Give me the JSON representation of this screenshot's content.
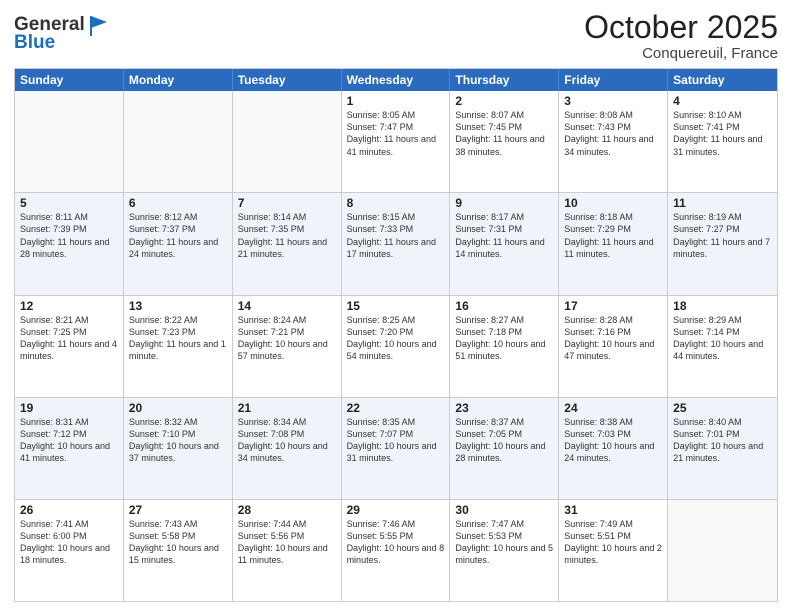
{
  "logo": {
    "line1": "General",
    "line2": "Blue"
  },
  "header": {
    "month": "October 2025",
    "location": "Conquereuil, France"
  },
  "days": [
    "Sunday",
    "Monday",
    "Tuesday",
    "Wednesday",
    "Thursday",
    "Friday",
    "Saturday"
  ],
  "rows": [
    [
      {
        "day": "",
        "text": ""
      },
      {
        "day": "",
        "text": ""
      },
      {
        "day": "",
        "text": ""
      },
      {
        "day": "1",
        "text": "Sunrise: 8:05 AM\nSunset: 7:47 PM\nDaylight: 11 hours and 41 minutes."
      },
      {
        "day": "2",
        "text": "Sunrise: 8:07 AM\nSunset: 7:45 PM\nDaylight: 11 hours and 38 minutes."
      },
      {
        "day": "3",
        "text": "Sunrise: 8:08 AM\nSunset: 7:43 PM\nDaylight: 11 hours and 34 minutes."
      },
      {
        "day": "4",
        "text": "Sunrise: 8:10 AM\nSunset: 7:41 PM\nDaylight: 11 hours and 31 minutes."
      }
    ],
    [
      {
        "day": "5",
        "text": "Sunrise: 8:11 AM\nSunset: 7:39 PM\nDaylight: 11 hours and 28 minutes."
      },
      {
        "day": "6",
        "text": "Sunrise: 8:12 AM\nSunset: 7:37 PM\nDaylight: 11 hours and 24 minutes."
      },
      {
        "day": "7",
        "text": "Sunrise: 8:14 AM\nSunset: 7:35 PM\nDaylight: 11 hours and 21 minutes."
      },
      {
        "day": "8",
        "text": "Sunrise: 8:15 AM\nSunset: 7:33 PM\nDaylight: 11 hours and 17 minutes."
      },
      {
        "day": "9",
        "text": "Sunrise: 8:17 AM\nSunset: 7:31 PM\nDaylight: 11 hours and 14 minutes."
      },
      {
        "day": "10",
        "text": "Sunrise: 8:18 AM\nSunset: 7:29 PM\nDaylight: 11 hours and 11 minutes."
      },
      {
        "day": "11",
        "text": "Sunrise: 8:19 AM\nSunset: 7:27 PM\nDaylight: 11 hours and 7 minutes."
      }
    ],
    [
      {
        "day": "12",
        "text": "Sunrise: 8:21 AM\nSunset: 7:25 PM\nDaylight: 11 hours and 4 minutes."
      },
      {
        "day": "13",
        "text": "Sunrise: 8:22 AM\nSunset: 7:23 PM\nDaylight: 11 hours and 1 minute."
      },
      {
        "day": "14",
        "text": "Sunrise: 8:24 AM\nSunset: 7:21 PM\nDaylight: 10 hours and 57 minutes."
      },
      {
        "day": "15",
        "text": "Sunrise: 8:25 AM\nSunset: 7:20 PM\nDaylight: 10 hours and 54 minutes."
      },
      {
        "day": "16",
        "text": "Sunrise: 8:27 AM\nSunset: 7:18 PM\nDaylight: 10 hours and 51 minutes."
      },
      {
        "day": "17",
        "text": "Sunrise: 8:28 AM\nSunset: 7:16 PM\nDaylight: 10 hours and 47 minutes."
      },
      {
        "day": "18",
        "text": "Sunrise: 8:29 AM\nSunset: 7:14 PM\nDaylight: 10 hours and 44 minutes."
      }
    ],
    [
      {
        "day": "19",
        "text": "Sunrise: 8:31 AM\nSunset: 7:12 PM\nDaylight: 10 hours and 41 minutes."
      },
      {
        "day": "20",
        "text": "Sunrise: 8:32 AM\nSunset: 7:10 PM\nDaylight: 10 hours and 37 minutes."
      },
      {
        "day": "21",
        "text": "Sunrise: 8:34 AM\nSunset: 7:08 PM\nDaylight: 10 hours and 34 minutes."
      },
      {
        "day": "22",
        "text": "Sunrise: 8:35 AM\nSunset: 7:07 PM\nDaylight: 10 hours and 31 minutes."
      },
      {
        "day": "23",
        "text": "Sunrise: 8:37 AM\nSunset: 7:05 PM\nDaylight: 10 hours and 28 minutes."
      },
      {
        "day": "24",
        "text": "Sunrise: 8:38 AM\nSunset: 7:03 PM\nDaylight: 10 hours and 24 minutes."
      },
      {
        "day": "25",
        "text": "Sunrise: 8:40 AM\nSunset: 7:01 PM\nDaylight: 10 hours and 21 minutes."
      }
    ],
    [
      {
        "day": "26",
        "text": "Sunrise: 7:41 AM\nSunset: 6:00 PM\nDaylight: 10 hours and 18 minutes."
      },
      {
        "day": "27",
        "text": "Sunrise: 7:43 AM\nSunset: 5:58 PM\nDaylight: 10 hours and 15 minutes."
      },
      {
        "day": "28",
        "text": "Sunrise: 7:44 AM\nSunset: 5:56 PM\nDaylight: 10 hours and 11 minutes."
      },
      {
        "day": "29",
        "text": "Sunrise: 7:46 AM\nSunset: 5:55 PM\nDaylight: 10 hours and 8 minutes."
      },
      {
        "day": "30",
        "text": "Sunrise: 7:47 AM\nSunset: 5:53 PM\nDaylight: 10 hours and 5 minutes."
      },
      {
        "day": "31",
        "text": "Sunrise: 7:49 AM\nSunset: 5:51 PM\nDaylight: 10 hours and 2 minutes."
      },
      {
        "day": "",
        "text": ""
      }
    ]
  ]
}
